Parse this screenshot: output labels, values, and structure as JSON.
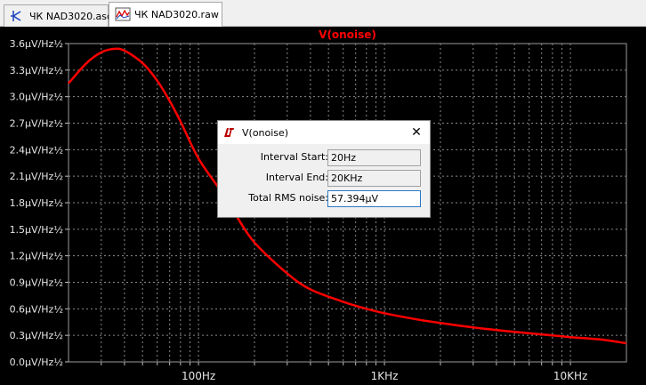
{
  "tabs": [
    {
      "label": "ЧК NAD3020.asc",
      "icon": "schematic-icon",
      "active": false
    },
    {
      "label": "ЧК NAD3020.raw",
      "icon": "waveform-icon",
      "active": true
    }
  ],
  "plot": {
    "trace_label": "V(onoise)",
    "trace_color": "#ff0000",
    "y_ticks": [
      "3.6µV/Hz½",
      "3.3µV/Hz½",
      "3.0µV/Hz½",
      "2.7µV/Hz½",
      "2.4µV/Hz½",
      "2.1µV/Hz½",
      "1.8µV/Hz½",
      "1.5µV/Hz½",
      "1.2µV/Hz½",
      "0.9µV/Hz½",
      "0.6µV/Hz½",
      "0.3µV/Hz½",
      "0.0µV/Hz½"
    ],
    "x_ticks": [
      "100Hz",
      "1KHz",
      "10KHz"
    ]
  },
  "chart_data": {
    "type": "line",
    "title": "V(onoise)",
    "xlabel": "",
    "ylabel": "",
    "x_scale": "log",
    "xlim": [
      20,
      20000
    ],
    "ylim": [
      0,
      3.6
    ],
    "grid": true,
    "series": [
      {
        "name": "V(onoise)",
        "color": "#ff0000",
        "x": [
          20,
          25,
          30,
          35,
          40,
          50,
          60,
          70,
          80,
          100,
          130,
          160,
          200,
          300,
          400,
          600,
          800,
          1000,
          1500,
          2000,
          3000,
          5000,
          8000,
          10000,
          15000,
          20000
        ],
        "y": [
          3.15,
          3.38,
          3.5,
          3.54,
          3.52,
          3.38,
          3.18,
          2.95,
          2.72,
          2.3,
          1.95,
          1.65,
          1.35,
          1.0,
          0.82,
          0.68,
          0.6,
          0.55,
          0.48,
          0.44,
          0.39,
          0.34,
          0.3,
          0.28,
          0.25,
          0.21
        ]
      }
    ]
  },
  "dialog": {
    "title": "V(onoise)",
    "close_label": "✕",
    "fields": [
      {
        "label": "Interval Start:",
        "value": "20Hz"
      },
      {
        "label": "Interval End:",
        "value": "20KHz"
      },
      {
        "label": "Total RMS noise:",
        "value": "57.394µV"
      }
    ]
  }
}
